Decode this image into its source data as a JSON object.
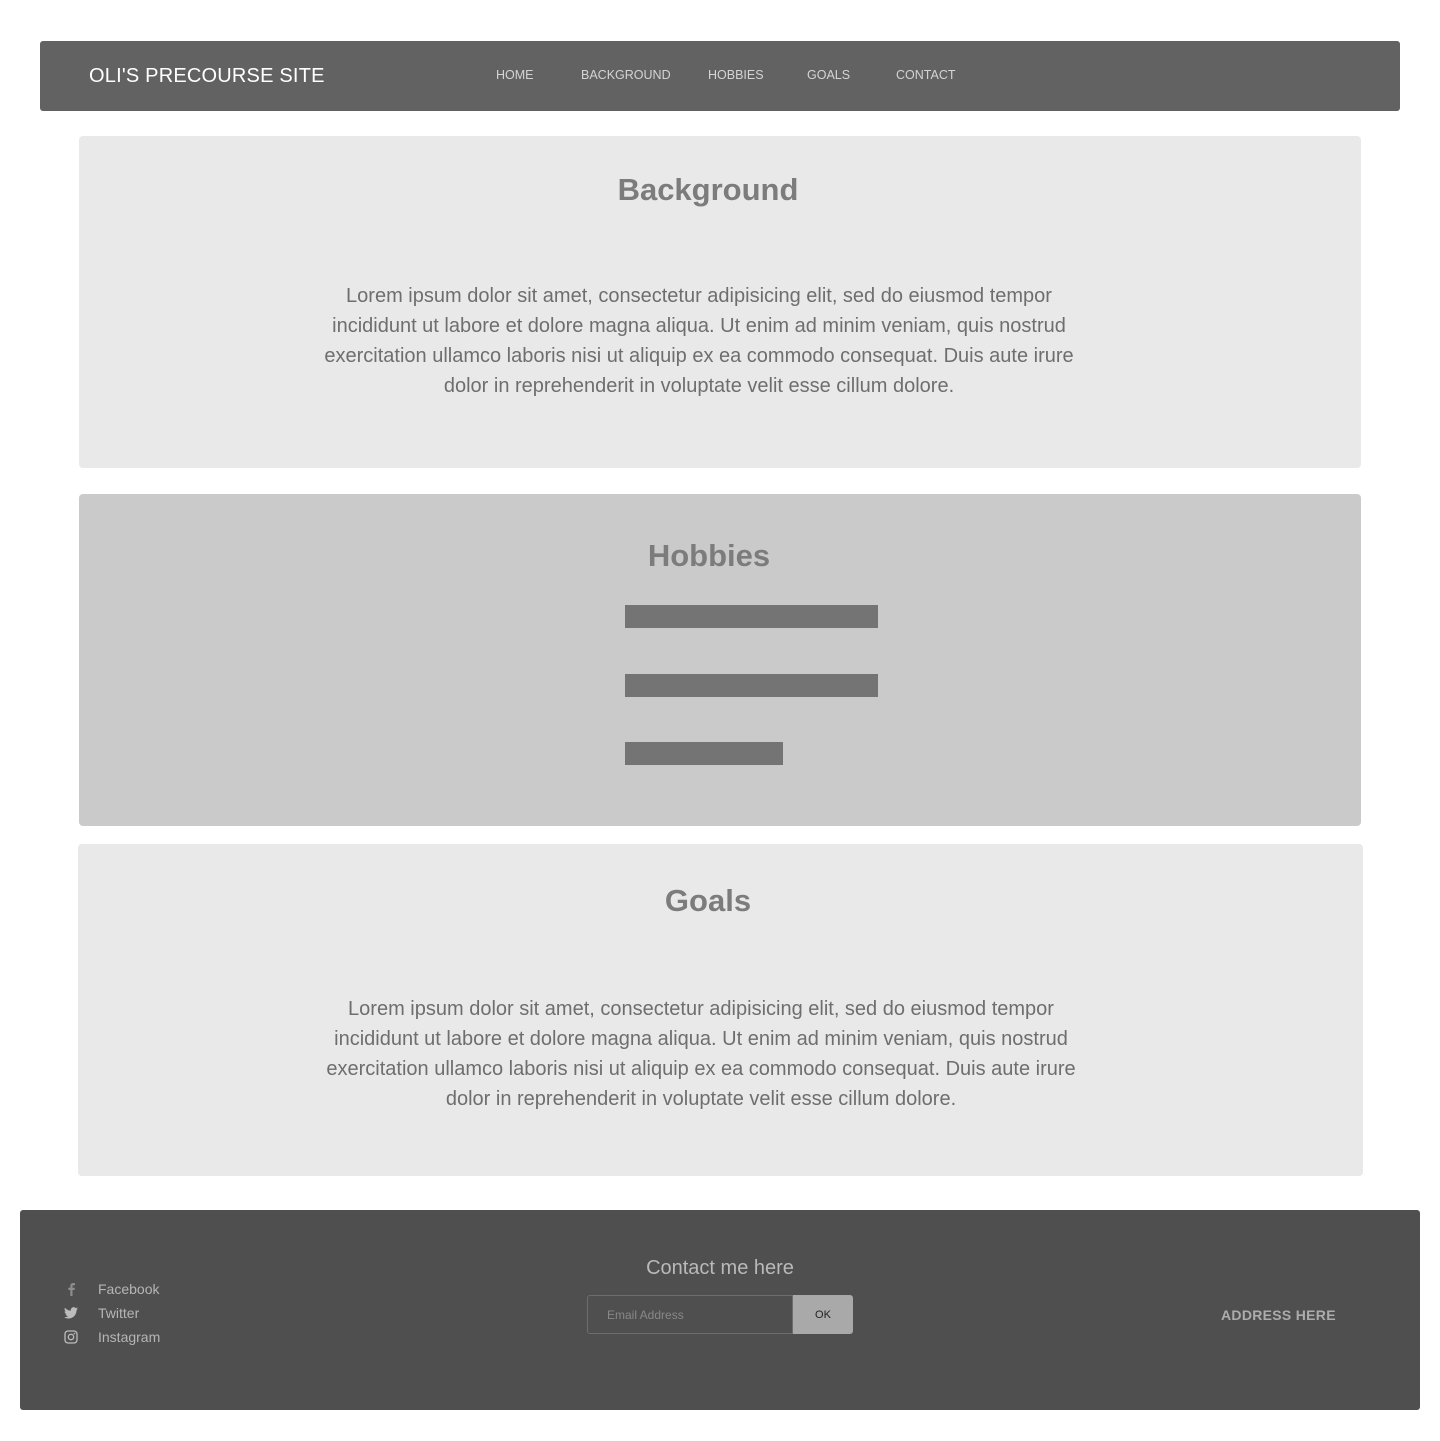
{
  "nav": {
    "brand": "OLI'S PRECOURSE SITE",
    "links": [
      "HOME",
      "BACKGROUND",
      "HOBBIES",
      "GOALS",
      "CONTACT"
    ]
  },
  "background": {
    "title": "Background",
    "text": "Lorem ipsum dolor sit amet, consectetur adipisicing elit, sed do eiusmod tempor incididunt ut labore et dolore magna aliqua. Ut enim ad minim veniam, quis nostrud exercitation ullamco laboris nisi ut aliquip ex ea commodo consequat. Duis aute irure dolor in reprehenderit in voluptate velit esse cillum dolore."
  },
  "hobbies": {
    "title": "Hobbies"
  },
  "goals": {
    "title": "Goals",
    "text": "Lorem ipsum dolor sit amet, consectetur adipisicing elit, sed do eiusmod tempor incididunt ut labore et dolore magna aliqua. Ut enim ad minim veniam, quis nostrud exercitation ullamco laboris nisi ut aliquip ex ea commodo consequat. Duis aute irure dolor in reprehenderit in voluptate velit esse cillum dolore."
  },
  "footer": {
    "social": [
      {
        "label": "Facebook",
        "icon": "facebook-icon"
      },
      {
        "label": "Twitter",
        "icon": "twitter-icon"
      },
      {
        "label": "Instagram",
        "icon": "instagram-icon"
      }
    ],
    "contact_title": "Contact me here",
    "email_placeholder": "Email Address",
    "ok_label": "OK",
    "address": "ADDRESS HERE"
  },
  "colors": {
    "nav_bg": "#626262",
    "section_light": "#e9e9e9",
    "section_dark": "#cacaca",
    "hobby_bar": "#747474",
    "footer_bg": "#4f4f4f"
  }
}
